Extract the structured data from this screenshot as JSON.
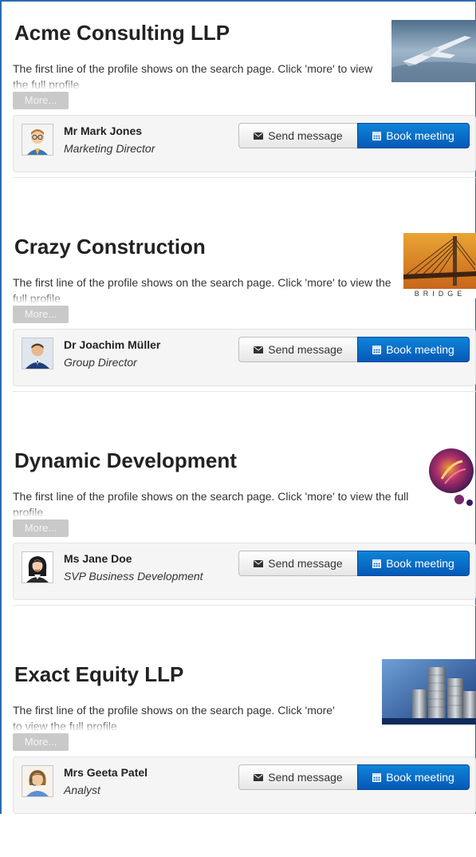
{
  "actions": {
    "more_label": "More...",
    "send_message_label": "Send message",
    "book_meeting_label": "Book meeting"
  },
  "companies": [
    {
      "name": "Acme Consulting LLP",
      "description": "The first line of the profile shows on the search page. Click 'more' to view the full profile",
      "logo_icon": "jet-plane-photo",
      "contact": {
        "name": "Mr Mark Jones",
        "role": "Marketing Director",
        "avatar_icon": "man-glasses-avatar"
      }
    },
    {
      "name": "Crazy Construction",
      "description": "The first line of the profile shows on the search page. Click 'more' to view the full profile",
      "logo_icon": "bridge-logo",
      "logo_text": "BRIDGE",
      "contact": {
        "name": "Dr Joachim Müller",
        "role": "Group Director",
        "avatar_icon": "man-suit-avatar"
      }
    },
    {
      "name": "Dynamic Development",
      "description": "The first line of the profile shows on the search page. Click 'more' to view the full profile",
      "logo_icon": "abstract-circles-logo",
      "contact": {
        "name": "Ms Jane Doe",
        "role": "SVP Business Development",
        "avatar_icon": "woman-avatar"
      }
    },
    {
      "name": "Exact Equity LLP",
      "description": "The first line of the profile shows on the search page. Click 'more' to view the full profile",
      "logo_icon": "coin-stacks-photo",
      "contact": {
        "name": "Mrs Geeta Patel",
        "role": "Analyst",
        "avatar_icon": "woman-headset-avatar"
      }
    }
  ],
  "colors": {
    "frame_border": "#2b6cb0",
    "book_button": "#0b6fcf",
    "more_button": "#c9c9c9",
    "card_background": "#f5f5f5"
  }
}
